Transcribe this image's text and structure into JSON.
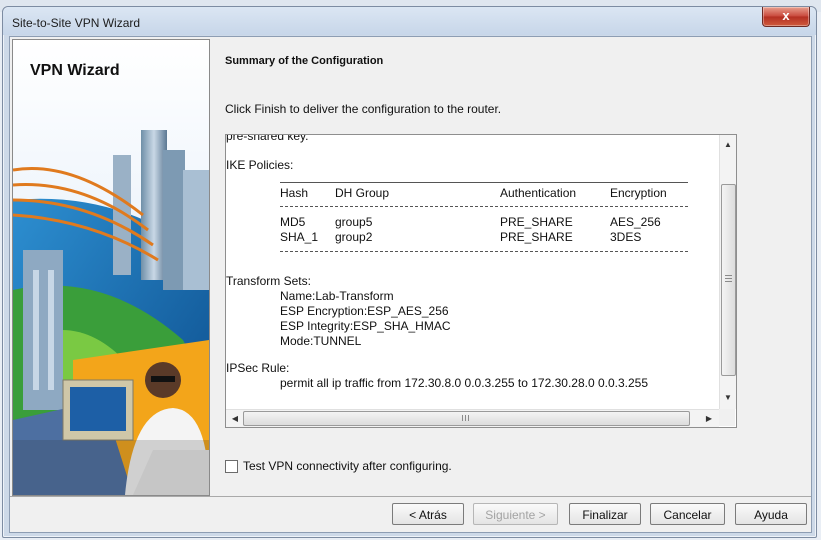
{
  "window": {
    "title": "Site-to-Site VPN Wizard",
    "close_glyph": "x"
  },
  "sidebar": {
    "title": "VPN Wizard"
  },
  "main": {
    "heading": "Summary of the Configuration",
    "instruction": "Click Finish to deliver the configuration to the router.",
    "summary": {
      "preshared_fragment": "pre-shared key.",
      "ike_label": "IKE Policies:",
      "ike_headers": [
        "Hash",
        "DH Group",
        "Authentication",
        "Encryption"
      ],
      "ike_rows": [
        [
          "MD5",
          "group5",
          "PRE_SHARE",
          "AES_256"
        ],
        [
          "SHA_1",
          "group2",
          "PRE_SHARE",
          "3DES"
        ]
      ],
      "transform_label": "Transform Sets:",
      "transform_lines": [
        "Name:Lab-Transform",
        "ESP Encryption:ESP_AES_256",
        "ESP Integrity:ESP_SHA_HMAC",
        "Mode:TUNNEL"
      ],
      "ipsec_label": "IPSec Rule:",
      "ipsec_line": "permit all ip traffic from 172.30.8.0 0.0.3.255 to 172.30.28.0 0.0.3.255"
    },
    "checkbox": {
      "label": "Test VPN connectivity after configuring.",
      "checked": false
    }
  },
  "buttons": {
    "back": "< Atrás",
    "next": "Siguiente >",
    "finish": "Finalizar",
    "cancel": "Cancelar",
    "help": "Ayuda"
  }
}
